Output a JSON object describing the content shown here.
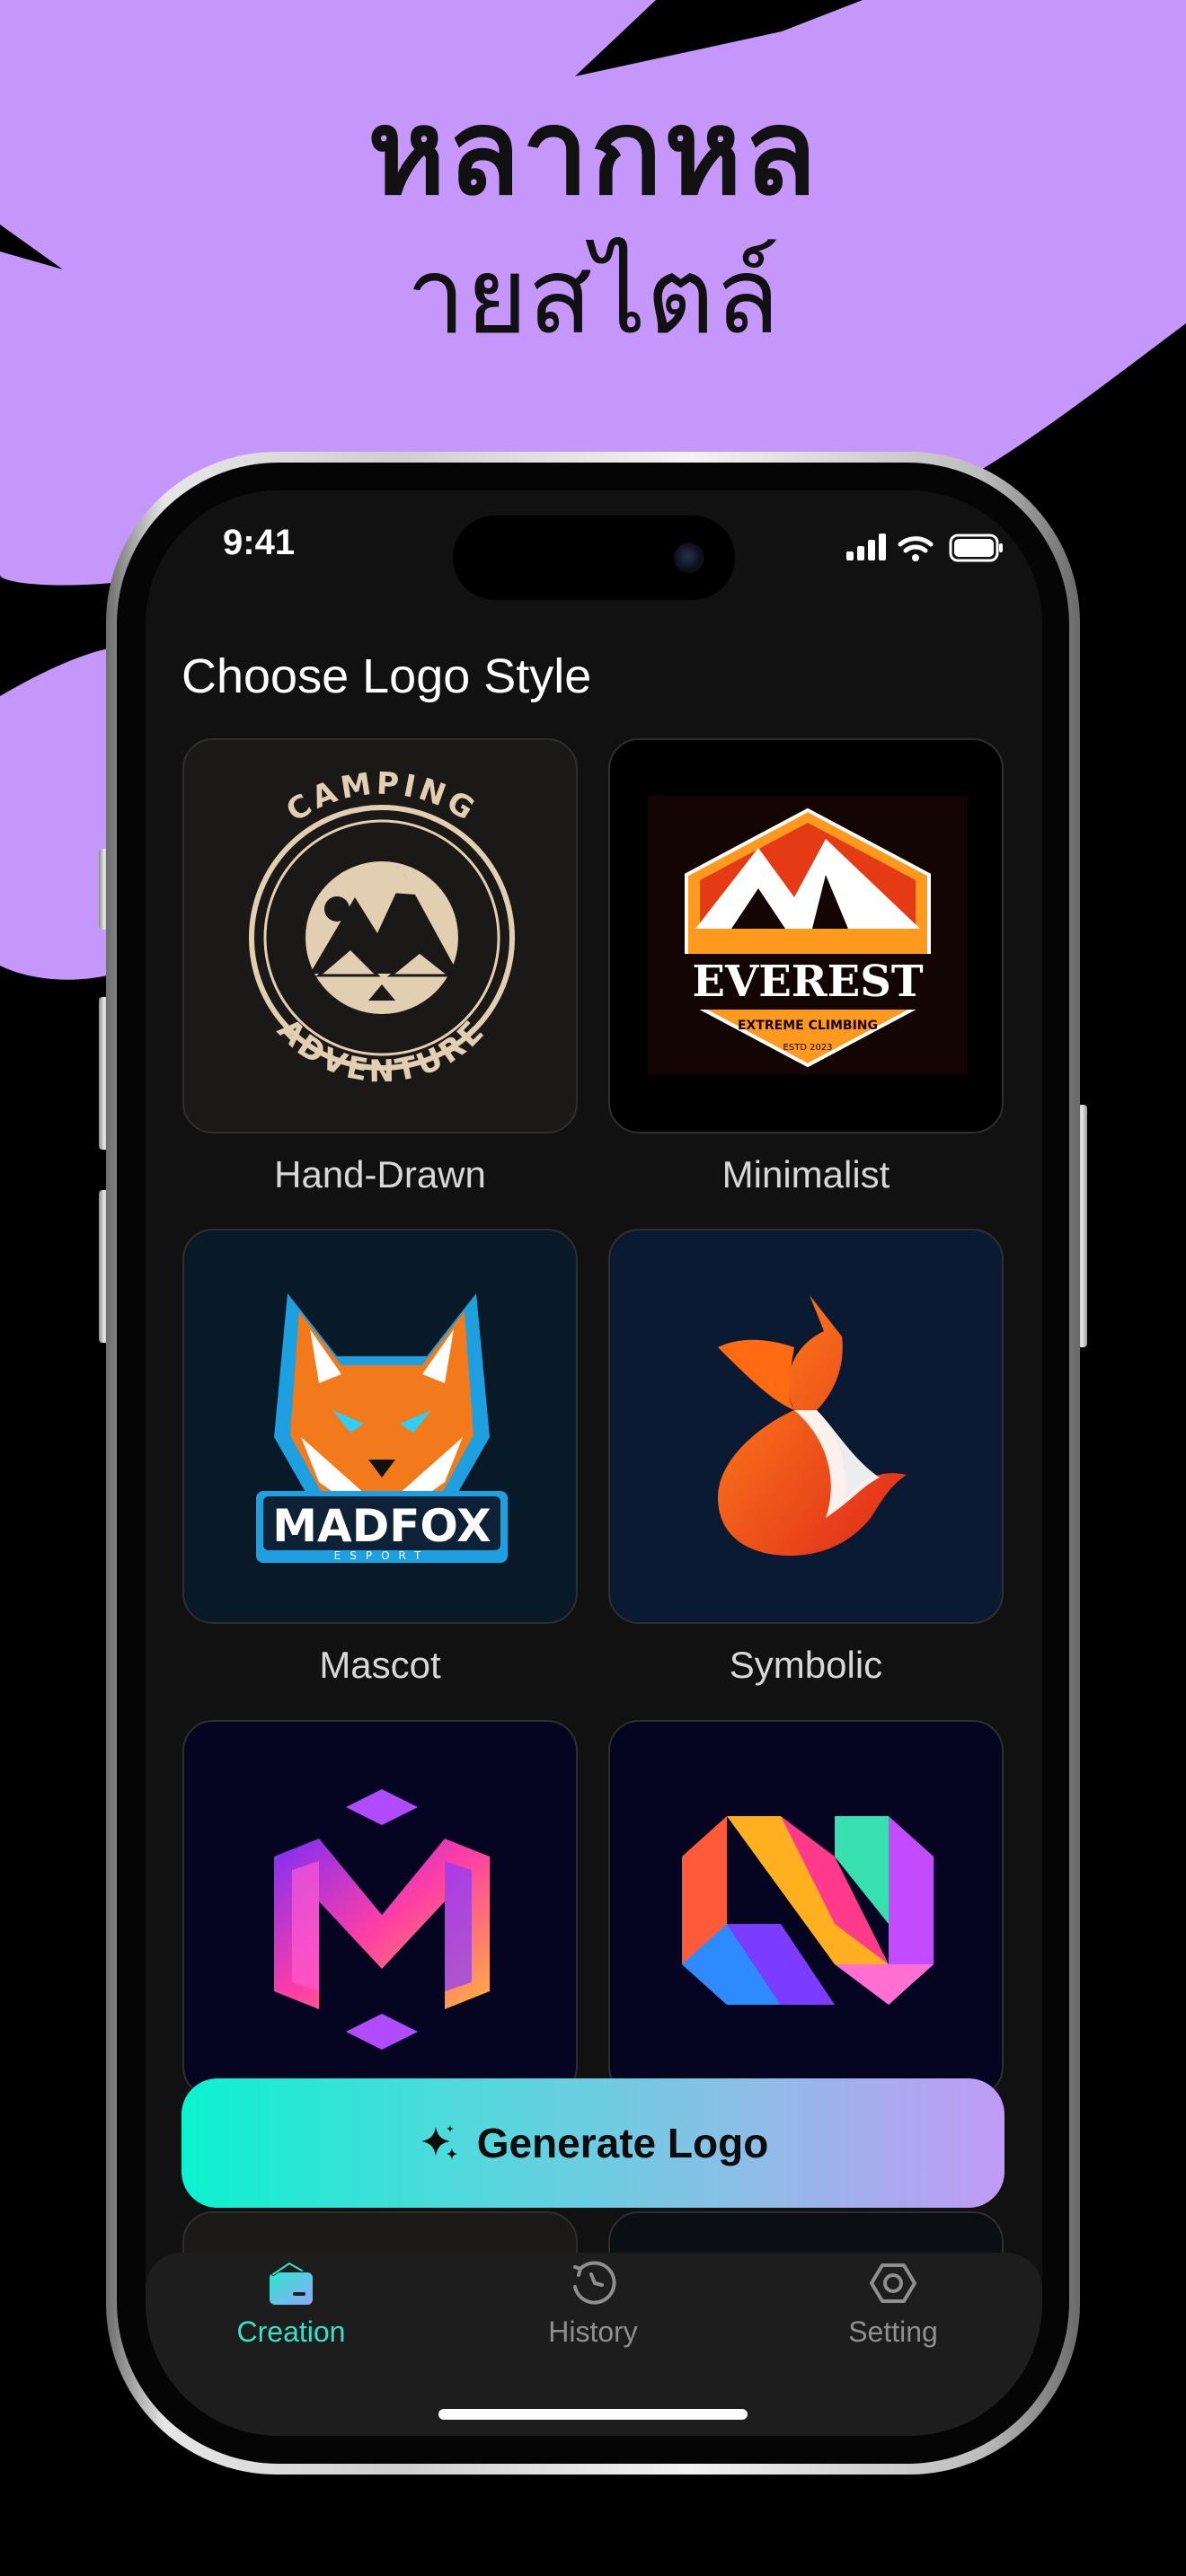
{
  "headline": {
    "line1": "หลากหล",
    "line2": "ายสไตล์"
  },
  "status_bar": {
    "time": "9:41"
  },
  "screen": {
    "title": "Choose Logo Style",
    "cards": [
      {
        "label": "Hand-Drawn",
        "art_text": "CAMPING ADVENTURE",
        "icon": "camping-badge-icon"
      },
      {
        "label": "Minimalist",
        "art_text": "EVEREST",
        "art_subtext": "EXTREME CLIMBING",
        "art_small": "ESTD 2023",
        "icon": "mountain-badge-icon"
      },
      {
        "label": "Mascot",
        "art_text": "MADFOX",
        "art_subtext": "ESPORT",
        "icon": "fox-mascot-icon"
      },
      {
        "label": "Symbolic",
        "icon": "fox-tail-icon"
      },
      {
        "label": "",
        "icon": "m-monogram-icon"
      },
      {
        "label": "",
        "icon": "n-monogram-icon"
      }
    ],
    "generate_button": "Generate Logo"
  },
  "tabbar": {
    "tabs": [
      {
        "label": "Creation",
        "icon": "creation-icon",
        "active": true
      },
      {
        "label": "History",
        "icon": "history-icon",
        "active": false
      },
      {
        "label": "Setting",
        "icon": "setting-icon",
        "active": false
      }
    ]
  },
  "colors": {
    "background_shape": "#c597fb",
    "screen_bg": "#111111",
    "accent_teal": "#38e0c8",
    "button_gradient_start": "#0cf2cf",
    "button_gradient_end": "#c09af6"
  }
}
